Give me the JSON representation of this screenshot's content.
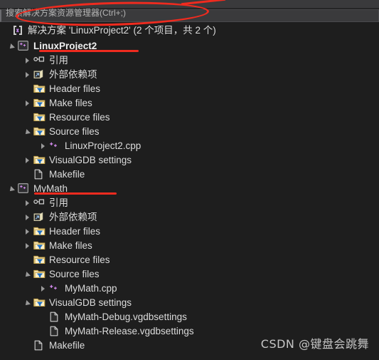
{
  "window": {
    "background_color": "#1e1e1e",
    "accent_color": "#ef2b1f"
  },
  "search": {
    "placeholder": "搜索解决方案资源管理器(Ctrl+;)"
  },
  "solution": {
    "icon": "solution-icon",
    "label": "解决方案 'LinuxProject2' (2 个项目，共 2 个)"
  },
  "tree": [
    {
      "indent": 0,
      "expander": "expanded",
      "icon": "cpp-project-icon",
      "label": "LinuxProject2",
      "bold": true
    },
    {
      "indent": 1,
      "expander": "collapsed",
      "icon": "references-icon",
      "label": "引用"
    },
    {
      "indent": 1,
      "expander": "collapsed",
      "icon": "external-deps-icon",
      "label": "外部依赖项"
    },
    {
      "indent": 1,
      "expander": "none",
      "icon": "filter-folder-icon",
      "label": "Header files"
    },
    {
      "indent": 1,
      "expander": "collapsed",
      "icon": "filter-folder-icon",
      "label": "Make files"
    },
    {
      "indent": 1,
      "expander": "none",
      "icon": "filter-folder-icon",
      "label": "Resource files"
    },
    {
      "indent": 1,
      "expander": "expanded",
      "icon": "filter-folder-icon",
      "label": "Source files"
    },
    {
      "indent": 2,
      "expander": "collapsed",
      "icon": "cpp-file-icon",
      "label": "LinuxProject2.cpp"
    },
    {
      "indent": 1,
      "expander": "collapsed",
      "icon": "filter-folder-icon",
      "label": "VisualGDB settings"
    },
    {
      "indent": 1,
      "expander": "none",
      "icon": "file-icon",
      "label": "Makefile"
    },
    {
      "indent": 0,
      "expander": "expanded",
      "icon": "cpp-project-icon",
      "label": "MyMath"
    },
    {
      "indent": 1,
      "expander": "collapsed",
      "icon": "references-icon",
      "label": "引用"
    },
    {
      "indent": 1,
      "expander": "collapsed",
      "icon": "external-deps-icon",
      "label": "外部依赖项"
    },
    {
      "indent": 1,
      "expander": "collapsed",
      "icon": "filter-folder-icon",
      "label": "Header files"
    },
    {
      "indent": 1,
      "expander": "collapsed",
      "icon": "filter-folder-icon",
      "label": "Make files"
    },
    {
      "indent": 1,
      "expander": "none",
      "icon": "filter-folder-icon",
      "label": "Resource files"
    },
    {
      "indent": 1,
      "expander": "expanded",
      "icon": "filter-folder-icon",
      "label": "Source files"
    },
    {
      "indent": 2,
      "expander": "collapsed",
      "icon": "cpp-file-icon",
      "label": "MyMath.cpp"
    },
    {
      "indent": 1,
      "expander": "expanded",
      "icon": "filter-folder-icon",
      "label": "VisualGDB settings"
    },
    {
      "indent": 2,
      "expander": "none",
      "icon": "file-icon",
      "label": "MyMath-Debug.vgdbsettings"
    },
    {
      "indent": 2,
      "expander": "none",
      "icon": "file-icon",
      "label": "MyMath-Release.vgdbsettings"
    },
    {
      "indent": 1,
      "expander": "none",
      "icon": "file-icon",
      "label": "Makefile"
    }
  ],
  "annotations": {
    "ellipse_target": "solution-row",
    "underline_1_target": "LinuxProject2",
    "underline_2_target": "MyMath"
  },
  "watermark": {
    "text": "CSDN @键盘会跳舞"
  }
}
